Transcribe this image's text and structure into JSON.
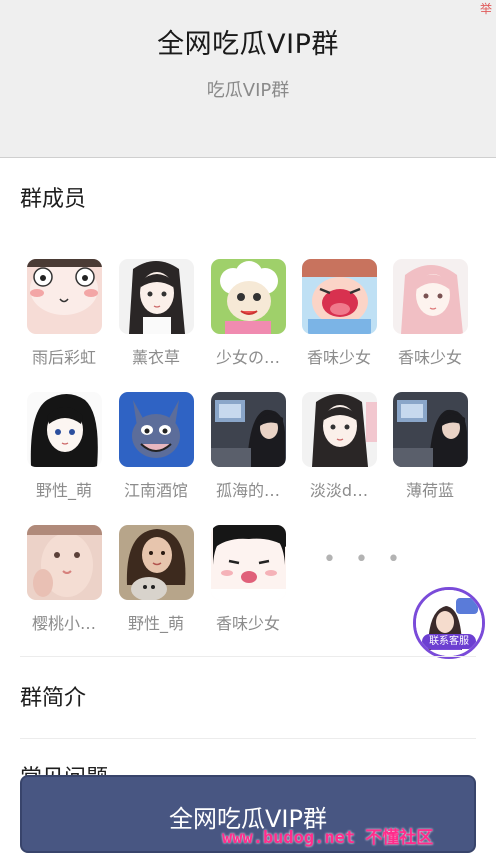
{
  "header": {
    "title": "全网吃瓜VIP群",
    "subtitle": "吃瓜VIP群",
    "report_label": "举"
  },
  "members_section": {
    "title": "群成员",
    "members": [
      {
        "name": "雨后彩虹",
        "avatar_icon": "cartoon-face-avatar",
        "color": "#f4d3cc"
      },
      {
        "name": "薰衣草",
        "avatar_icon": "anime-girl-avatar",
        "color": "#e9e9e9"
      },
      {
        "name": "少女の…",
        "avatar_icon": "cartoon-sheep-avatar",
        "color": "#f0e3c0"
      },
      {
        "name": "香味少女",
        "avatar_icon": "crying-cartoon-avatar",
        "color": "#b9d9f0"
      },
      {
        "name": "香味少女",
        "avatar_icon": "pink-hair-girl-avatar",
        "color": "#f3eaea"
      },
      {
        "name": "野性_萌",
        "avatar_icon": "anime-girl-avatar",
        "color": "#f7f7f7"
      },
      {
        "name": "江南酒馆",
        "avatar_icon": "cartoon-cat-avatar",
        "color": "#3a5fb8"
      },
      {
        "name": "孤海的…",
        "avatar_icon": "gamer-girl-avatar",
        "color": "#4b4f5a"
      },
      {
        "name": "淡淡d…",
        "avatar_icon": "anime-girl-avatar",
        "color": "#ececec"
      },
      {
        "name": "薄荷蓝",
        "avatar_icon": "gamer-girl-avatar",
        "color": "#4b4f5a"
      },
      {
        "name": "樱桃小…",
        "avatar_icon": "photo-girl-avatar",
        "color": "#e8c3b6"
      },
      {
        "name": "野性_萌",
        "avatar_icon": "girl-with-dog-avatar",
        "color": "#8b7b66"
      },
      {
        "name": "香味少女",
        "avatar_icon": "anime-face-avatar",
        "color": "#fbe9e4"
      }
    ],
    "more_label": "• • •"
  },
  "intro_section": {
    "title": "群简介"
  },
  "faq_section": {
    "title": "常见问题"
  },
  "customer_service": {
    "label": "联系客服",
    "icon": "customer-service-icon"
  },
  "join_button": {
    "label": "全网吃瓜VIP群"
  },
  "watermark": {
    "text": "www.budog.net 不懂社区"
  },
  "colors": {
    "header_bg": "#efefef",
    "button_bg": "#485682",
    "watermark": "#ff2d8c",
    "cs_accent": "#6c3fd1"
  }
}
